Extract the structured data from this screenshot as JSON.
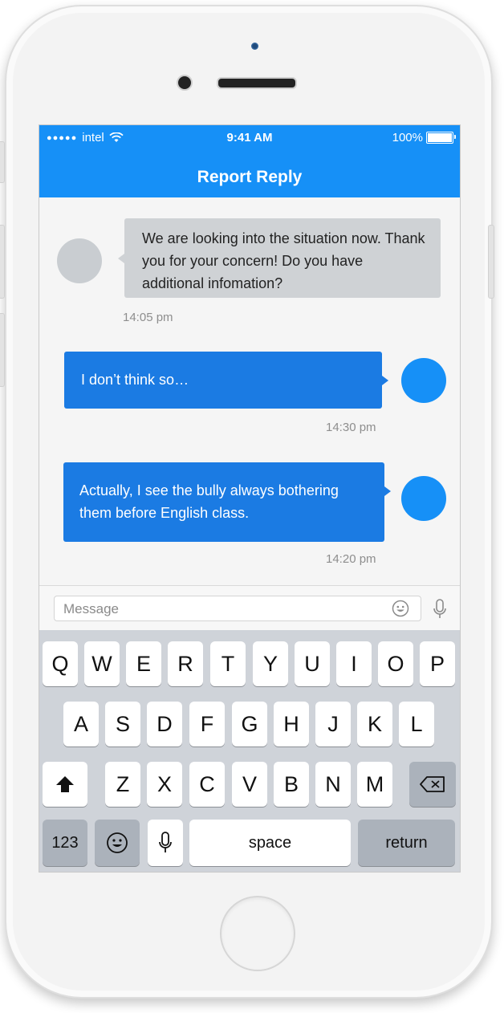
{
  "status_bar": {
    "signal_dots": "●●●●●",
    "carrier": "intel",
    "time": "9:41 AM",
    "battery": "100%"
  },
  "nav": {
    "title": "Report Reply"
  },
  "messages": [
    {
      "direction": "incoming",
      "text": "We are looking into the situation now. Thank you for your concern! Do you have additional infomation?",
      "time": "14:05 pm"
    },
    {
      "direction": "outgoing",
      "text": "I don’t think so…",
      "time": "14:30 pm"
    },
    {
      "direction": "outgoing",
      "text": "Actually, I see the bully always bothering them before English class.",
      "time": "14:20 pm"
    }
  ],
  "input": {
    "placeholder": "Message"
  },
  "keyboard": {
    "row1": [
      "Q",
      "W",
      "E",
      "R",
      "T",
      "Y",
      "U",
      "I",
      "O",
      "P"
    ],
    "row2": [
      "A",
      "S",
      "D",
      "F",
      "G",
      "H",
      "J",
      "K",
      "L"
    ],
    "row3": [
      "Z",
      "X",
      "C",
      "V",
      "B",
      "N",
      "M"
    ],
    "numbers_label": "123",
    "space_label": "space",
    "return_label": "return"
  },
  "colors": {
    "accent": "#1690f7",
    "outgoing_bubble": "#1b7be3",
    "incoming_bubble": "#cfd2d5"
  }
}
